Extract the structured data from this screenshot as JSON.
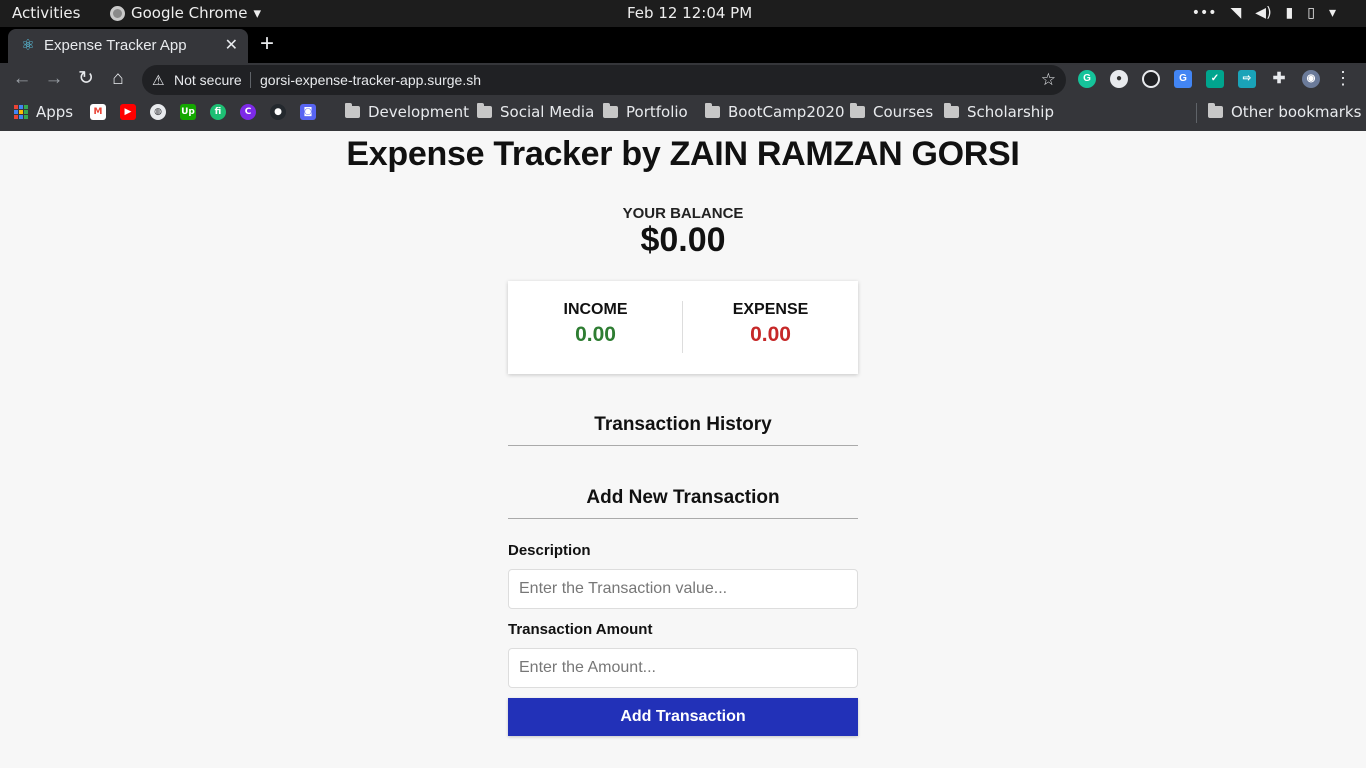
{
  "os_bar": {
    "activities": "Activities",
    "app_name": "Google Chrome",
    "clock": "Feb 12  12:04 PM"
  },
  "browser": {
    "tab_title": "Expense Tracker App",
    "security_label": "Not secure",
    "url": "gorsi-expense-tracker-app.surge.sh",
    "bookmarks": {
      "apps": "Apps",
      "folders": [
        "Development",
        "Social Media",
        "Portfolio",
        "BootCamp2020",
        "Courses",
        "Scholarship"
      ],
      "other": "Other bookmarks"
    }
  },
  "app": {
    "title": "Expense Tracker by ZAIN RAMZAN GORSI",
    "balance_label": "YOUR BALANCE",
    "balance_value": "$0.00",
    "income_label": "INCOME",
    "income_value": "0.00",
    "expense_label": "EXPENSE",
    "expense_value": "0.00",
    "history_heading": "Transaction History",
    "add_heading": "Add New Transaction",
    "description_label": "Description",
    "description_placeholder": "Enter the Transaction value...",
    "amount_label": "Transaction Amount",
    "amount_placeholder": "Enter the Amount...",
    "submit_label": "Add Transaction"
  },
  "colors": {
    "income": "#2e7d32",
    "expense": "#c62828",
    "button": "#2231b8"
  }
}
